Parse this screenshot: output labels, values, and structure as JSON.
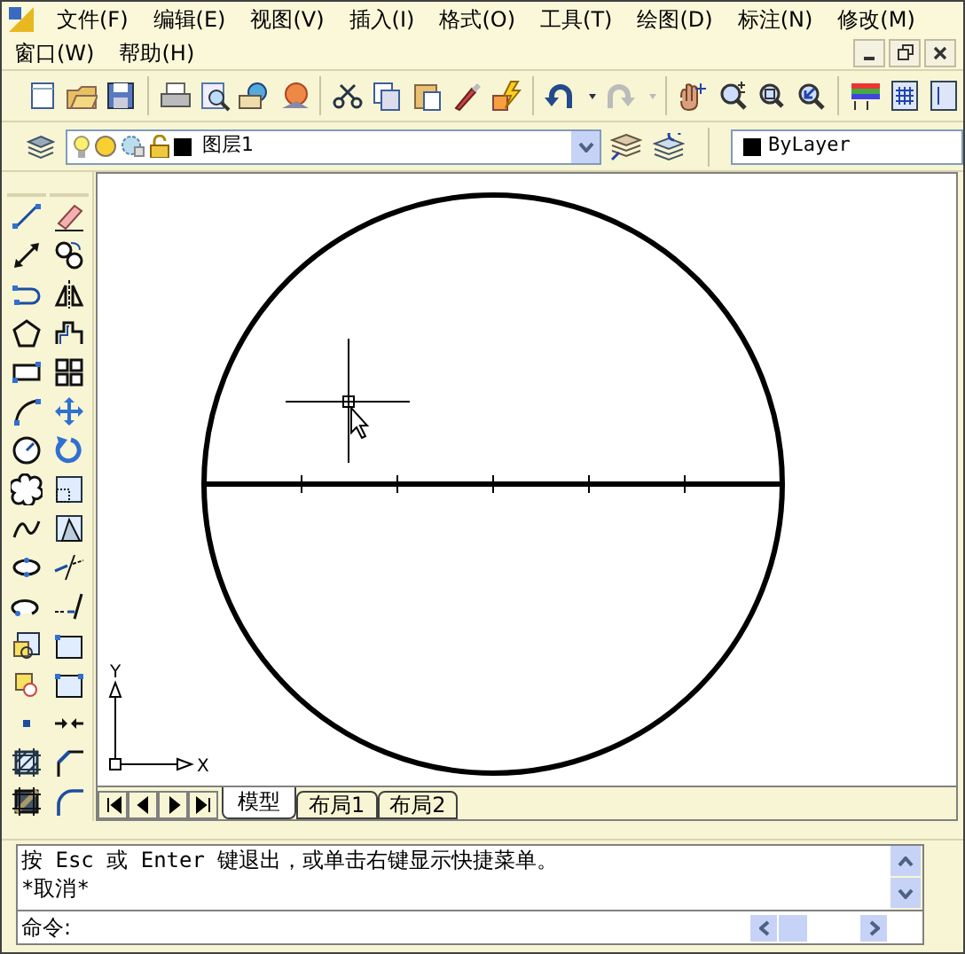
{
  "menu_bar": {
    "rows": [
      [
        {
          "label": "文件(F)"
        },
        {
          "label": "编辑(E)"
        },
        {
          "label": "视图(V)"
        },
        {
          "label": "插入(I)"
        },
        {
          "label": "格式(O)"
        },
        {
          "label": "工具(T)"
        },
        {
          "label": "绘图(D)"
        },
        {
          "label": "标注(N)"
        },
        {
          "label": "修改(M)"
        }
      ],
      [
        {
          "label": "窗口(W)"
        },
        {
          "label": "帮助(H)"
        }
      ]
    ]
  },
  "layer_toolbar": {
    "layer": "图层1",
    "color_control": "ByLayer"
  },
  "drawing": {
    "ucs": {
      "x_label": "X",
      "y_label": "Y"
    }
  },
  "layout_tabs": [
    {
      "label": "模型",
      "selected": true
    },
    {
      "label": "布局1",
      "selected": false
    },
    {
      "label": "布局2",
      "selected": false
    }
  ],
  "command_window": {
    "history": [
      "按 Esc 或 Enter 键退出，或单击右键显示快捷菜单。",
      "*取消*"
    ],
    "prompt": "命令:"
  }
}
